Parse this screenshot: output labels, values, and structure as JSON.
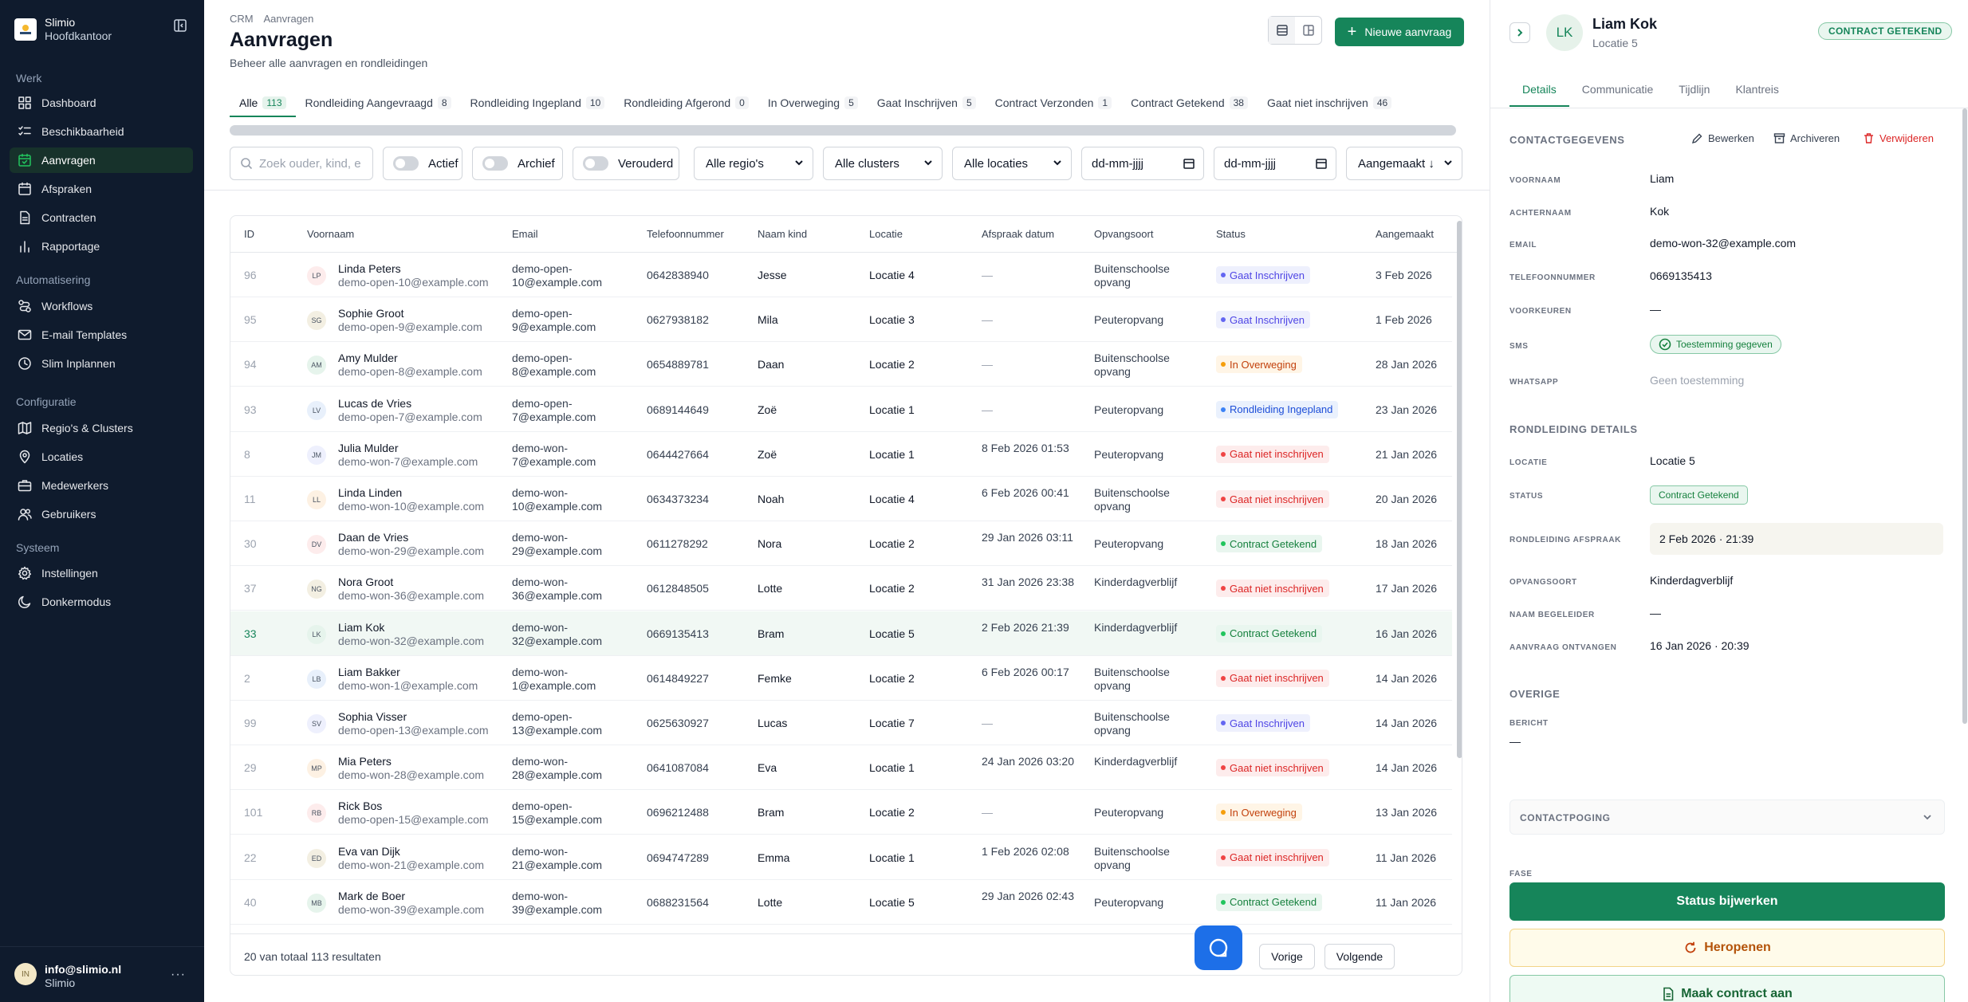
{
  "brand": {
    "name": "Slimio",
    "sub": "Hoofdkantoor"
  },
  "nav": {
    "sections": [
      {
        "label": "Werk",
        "items": [
          {
            "label": "Dashboard",
            "icon": "grid-icon"
          },
          {
            "label": "Beschikbaarheid",
            "icon": "checklist-icon"
          },
          {
            "label": "Aanvragen",
            "icon": "calendar-check-icon",
            "active": true
          },
          {
            "label": "Afspraken",
            "icon": "calendar-icon"
          },
          {
            "label": "Contracten",
            "icon": "document-icon"
          },
          {
            "label": "Rapportage",
            "icon": "bar-chart-icon"
          }
        ]
      },
      {
        "label": "Automatisering",
        "items": [
          {
            "label": "Workflows",
            "icon": "workflow-icon"
          },
          {
            "label": "E-mail Templates",
            "icon": "mail-icon"
          },
          {
            "label": "Slim Inplannen",
            "icon": "clock-icon"
          }
        ]
      },
      {
        "label": "Configuratie",
        "items": [
          {
            "label": "Regio's & Clusters",
            "icon": "map-icon"
          },
          {
            "label": "Locaties",
            "icon": "pin-icon"
          },
          {
            "label": "Medewerkers",
            "icon": "briefcase-icon"
          },
          {
            "label": "Gebruikers",
            "icon": "users-icon"
          }
        ]
      },
      {
        "label": "Systeem",
        "items": [
          {
            "label": "Instellingen",
            "icon": "gear-icon"
          },
          {
            "label": "Donkermodus",
            "icon": "moon-icon"
          }
        ]
      }
    ]
  },
  "user": {
    "initials": "IN",
    "email": "info@slimio.nl",
    "org": "Slimio",
    "menu": "···"
  },
  "header": {
    "breadcrumb": [
      "CRM",
      "Aanvragen"
    ],
    "title": "Aanvragen",
    "subtitle": "Beheer alle aanvragen en rondleidingen",
    "new_button": "Nieuwe aanvraag"
  },
  "tabs": [
    {
      "label": "Alle",
      "count": "113",
      "active": true
    },
    {
      "label": "Rondleiding Aangevraagd",
      "count": "8"
    },
    {
      "label": "Rondleiding Ingepland",
      "count": "10"
    },
    {
      "label": "Rondleiding Afgerond",
      "count": "0"
    },
    {
      "label": "In Overweging",
      "count": "5"
    },
    {
      "label": "Gaat Inschrijven",
      "count": "5"
    },
    {
      "label": "Contract Verzonden",
      "count": "1"
    },
    {
      "label": "Contract Getekend",
      "count": "38"
    },
    {
      "label": "Gaat niet inschrijven",
      "count": "46"
    }
  ],
  "filters": {
    "search_placeholder": "Zoek ouder, kind, e",
    "toggle_actief": "Actief",
    "toggle_archief": "Archief",
    "toggle_verouderd": "Verouderd",
    "regio": "Alle regio's",
    "clusters": "Alle clusters",
    "locaties": "Alle locaties",
    "date_from": "dd-mm-jjjj",
    "date_to": "dd-mm-jjjj",
    "sort": "Aangemaakt ↓"
  },
  "table": {
    "columns": [
      "ID",
      "Voornaam",
      "Email",
      "Telefoonnummer",
      "Naam kind",
      "Locatie",
      "Afspraak datum",
      "Opvangsoort",
      "Status",
      "Aangemaakt"
    ],
    "rows": [
      {
        "id": "96",
        "initials": "LP",
        "name": "Linda Peters",
        "subemail": "demo-open-10@example.com",
        "email": "demo-open-10@example.com",
        "phone": "0642838940",
        "kind": "Jesse",
        "loc": "Locatie 4",
        "afspr": "—",
        "opv": "Buitenschoolse opvang",
        "status": "Gaat Inschrijven",
        "created": "3 Feb 2026"
      },
      {
        "id": "95",
        "initials": "SG",
        "name": "Sophie Groot",
        "subemail": "demo-open-9@example.com",
        "email": "demo-open-9@example.com",
        "phone": "0627938182",
        "kind": "Mila",
        "loc": "Locatie 3",
        "afspr": "—",
        "opv": "Peuteropvang",
        "status": "Gaat Inschrijven",
        "created": "1 Feb 2026"
      },
      {
        "id": "94",
        "initials": "AM",
        "name": "Amy Mulder",
        "subemail": "demo-open-8@example.com",
        "email": "demo-open-8@example.com",
        "phone": "0654889781",
        "kind": "Daan",
        "loc": "Locatie 2",
        "afspr": "—",
        "opv": "Buitenschoolse opvang",
        "status": "In Overweging",
        "created": "28 Jan 2026"
      },
      {
        "id": "93",
        "initials": "LV",
        "name": "Lucas de Vries",
        "subemail": "demo-open-7@example.com",
        "email": "demo-open-7@example.com",
        "phone": "0689144649",
        "kind": "Zoë",
        "loc": "Locatie 1",
        "afspr": "—",
        "opv": "Peuteropvang",
        "status": "Rondleiding Ingepland",
        "created": "23 Jan 2026"
      },
      {
        "id": "8",
        "initials": "JM",
        "name": "Julia Mulder",
        "subemail": "demo-won-7@example.com",
        "email": "demo-won-7@example.com",
        "phone": "0644427664",
        "kind": "Zoë",
        "loc": "Locatie 1",
        "afspr": "8 Feb 2026 01:53",
        "opv": "Peuteropvang",
        "status": "Gaat niet inschrijven",
        "created": "21 Jan 2026"
      },
      {
        "id": "11",
        "initials": "LL",
        "name": "Linda Linden",
        "subemail": "demo-won-10@example.com",
        "email": "demo-won-10@example.com",
        "phone": "0634373234",
        "kind": "Noah",
        "loc": "Locatie 4",
        "afspr": "6 Feb 2026 00:41",
        "opv": "Buitenschoolse opvang",
        "status": "Gaat niet inschrijven",
        "created": "20 Jan 2026"
      },
      {
        "id": "30",
        "initials": "DV",
        "name": "Daan de Vries",
        "subemail": "demo-won-29@example.com",
        "email": "demo-won-29@example.com",
        "phone": "0611278292",
        "kind": "Nora",
        "loc": "Locatie 2",
        "afspr": "29 Jan 2026 03:11",
        "opv": "Peuteropvang",
        "status": "Contract Getekend",
        "created": "18 Jan 2026"
      },
      {
        "id": "37",
        "initials": "NG",
        "name": "Nora Groot",
        "subemail": "demo-won-36@example.com",
        "email": "demo-won-36@example.com",
        "phone": "0612848505",
        "kind": "Lotte",
        "loc": "Locatie 2",
        "afspr": "31 Jan 2026 23:38",
        "opv": "Kinderdagverblijf",
        "status": "Gaat niet inschrijven",
        "created": "17 Jan 2026"
      },
      {
        "id": "33",
        "initials": "LK",
        "name": "Liam Kok",
        "subemail": "demo-won-32@example.com",
        "email": "demo-won-32@example.com",
        "phone": "0669135413",
        "kind": "Bram",
        "loc": "Locatie 5",
        "afspr": "2 Feb 2026 21:39",
        "opv": "Kinderdagverblijf",
        "status": "Contract Getekend",
        "created": "16 Jan 2026",
        "selected": true
      },
      {
        "id": "2",
        "initials": "LB",
        "name": "Liam Bakker",
        "subemail": "demo-won-1@example.com",
        "email": "demo-won-1@example.com",
        "phone": "0614849227",
        "kind": "Femke",
        "loc": "Locatie 2",
        "afspr": "6 Feb 2026 00:17",
        "opv": "Buitenschoolse opvang",
        "status": "Gaat niet inschrijven",
        "created": "14 Jan 2026"
      },
      {
        "id": "99",
        "initials": "SV",
        "name": "Sophia Visser",
        "subemail": "demo-open-13@example.com",
        "email": "demo-open-13@example.com",
        "phone": "0625630927",
        "kind": "Lucas",
        "loc": "Locatie 7",
        "afspr": "—",
        "opv": "Buitenschoolse opvang",
        "status": "Gaat Inschrijven",
        "created": "14 Jan 2026"
      },
      {
        "id": "29",
        "initials": "MP",
        "name": "Mia Peters",
        "subemail": "demo-won-28@example.com",
        "email": "demo-won-28@example.com",
        "phone": "0641087084",
        "kind": "Eva",
        "loc": "Locatie 1",
        "afspr": "24 Jan 2026 03:20",
        "opv": "Kinderdagverblijf",
        "status": "Gaat niet inschrijven",
        "created": "14 Jan 2026"
      },
      {
        "id": "101",
        "initials": "RB",
        "name": "Rick Bos",
        "subemail": "demo-open-15@example.com",
        "email": "demo-open-15@example.com",
        "phone": "0696212488",
        "kind": "Bram",
        "loc": "Locatie 2",
        "afspr": "—",
        "opv": "Peuteropvang",
        "status": "In Overweging",
        "created": "13 Jan 2026"
      },
      {
        "id": "22",
        "initials": "ED",
        "name": "Eva van Dijk",
        "subemail": "demo-won-21@example.com",
        "email": "demo-won-21@example.com",
        "phone": "0694747289",
        "kind": "Emma",
        "loc": "Locatie 1",
        "afspr": "1 Feb 2026 02:08",
        "opv": "Buitenschoolse opvang",
        "status": "Gaat niet inschrijven",
        "created": "11 Jan 2026"
      },
      {
        "id": "40",
        "initials": "MB",
        "name": "Mark de Boer",
        "subemail": "demo-won-39@example.com",
        "email": "demo-won-39@example.com",
        "phone": "0688231564",
        "kind": "Lotte",
        "loc": "Locatie 5",
        "afspr": "29 Jan 2026 02:43",
        "opv": "Peuteropvang",
        "status": "Contract Getekend",
        "created": "11 Jan 2026"
      }
    ],
    "footer_total": "20 van totaal 113 resultaten",
    "prev": "Vorige",
    "next": "Volgende"
  },
  "status_colors": {
    "Gaat Inschrijven": {
      "fg": "#4f46e5",
      "bg": "#eef0fd",
      "dot": "#6366f1"
    },
    "In Overweging": {
      "fg": "#c2410c",
      "bg": "#fff5e6",
      "dot": "#f59e0b"
    },
    "Rondleiding Ingepland": {
      "fg": "#1d4ed8",
      "bg": "#eaf1fd",
      "dot": "#3b82f6"
    },
    "Gaat niet inschrijven": {
      "fg": "#dc2626",
      "bg": "#fdecec",
      "dot": "#ef4444"
    },
    "Contract Getekend": {
      "fg": "#15803d",
      "bg": "#e9f6ef",
      "dot": "#22c55e"
    }
  },
  "avatar_colors": [
    "#fdecec",
    "#f3efe2",
    "#e6f4ec",
    "#e8f0fb",
    "#eef0fd",
    "#fdf1e3"
  ],
  "panel": {
    "initials": "LK",
    "name": "Liam Kok",
    "location": "Locatie 5",
    "badge": "CONTRACT GETEKEND",
    "tabs": [
      "Details",
      "Communicatie",
      "Tijdlijn",
      "Klantreis"
    ],
    "contact_title": "CONTACTGEGEVENS",
    "edit": "Bewerken",
    "archive": "Archiveren",
    "delete": "Verwijderen",
    "fields": {
      "voornaam_label": "VOORNAAM",
      "voornaam": "Liam",
      "achternaam_label": "ACHTERNAAM",
      "achternaam": "Kok",
      "email_label": "EMAIL",
      "email": "demo-won-32@example.com",
      "telefoon_label": "TELEFOONNUMMER",
      "telefoon": "0669135413",
      "voorkeuren_label": "VOORKEUREN",
      "voorkeuren": "—",
      "sms_label": "SMS",
      "sms": "Toestemming gegeven",
      "whatsapp_label": "WHATSAPP",
      "whatsapp": "Geen toestemming"
    },
    "tour_title": "RONDLEIDING DETAILS",
    "tour": {
      "locatie_label": "LOCATIE",
      "locatie": "Locatie 5",
      "status_label": "STATUS",
      "status": "Contract Getekend",
      "afspraak_label": "RONDLEIDING AFSPRAAK",
      "afspraak": "2 Feb 2026 · 21:39",
      "opvang_label": "OPVANGSOORT",
      "opvang": "Kinderdagverblijf",
      "begeleider_label": "NAAM BEGELEIDER",
      "begeleider": "—",
      "ontvangen_label": "AANVRAAG ONTVANGEN",
      "ontvangen": "16 Jan 2026 · 20:39"
    },
    "other_title": "OVERIGE",
    "bericht_label": "BERICHT",
    "bericht": "—",
    "contactpoging": "CONTACTPOGING",
    "fase": "FASE",
    "btn_status": "Status bijwerken",
    "btn_reopen": "Heropenen",
    "btn_contract": "Maak contract aan"
  }
}
